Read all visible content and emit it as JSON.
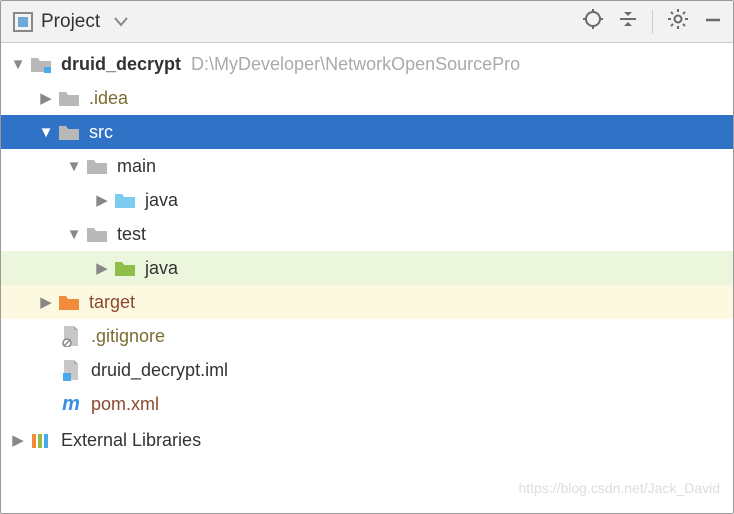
{
  "toolbar": {
    "title": "Project"
  },
  "project": {
    "name": "druid_decrypt",
    "path": "D:\\MyDeveloper\\NetworkOpenSourcePro",
    "idea": ".idea",
    "src": "src",
    "main": "main",
    "main_java": "java",
    "test": "test",
    "test_java": "java",
    "target": "target",
    "gitignore": ".gitignore",
    "iml": "druid_decrypt.iml",
    "pom": "pom.xml",
    "external": "External Libraries"
  },
  "watermark": "https://blog.csdn.net/Jack_David"
}
